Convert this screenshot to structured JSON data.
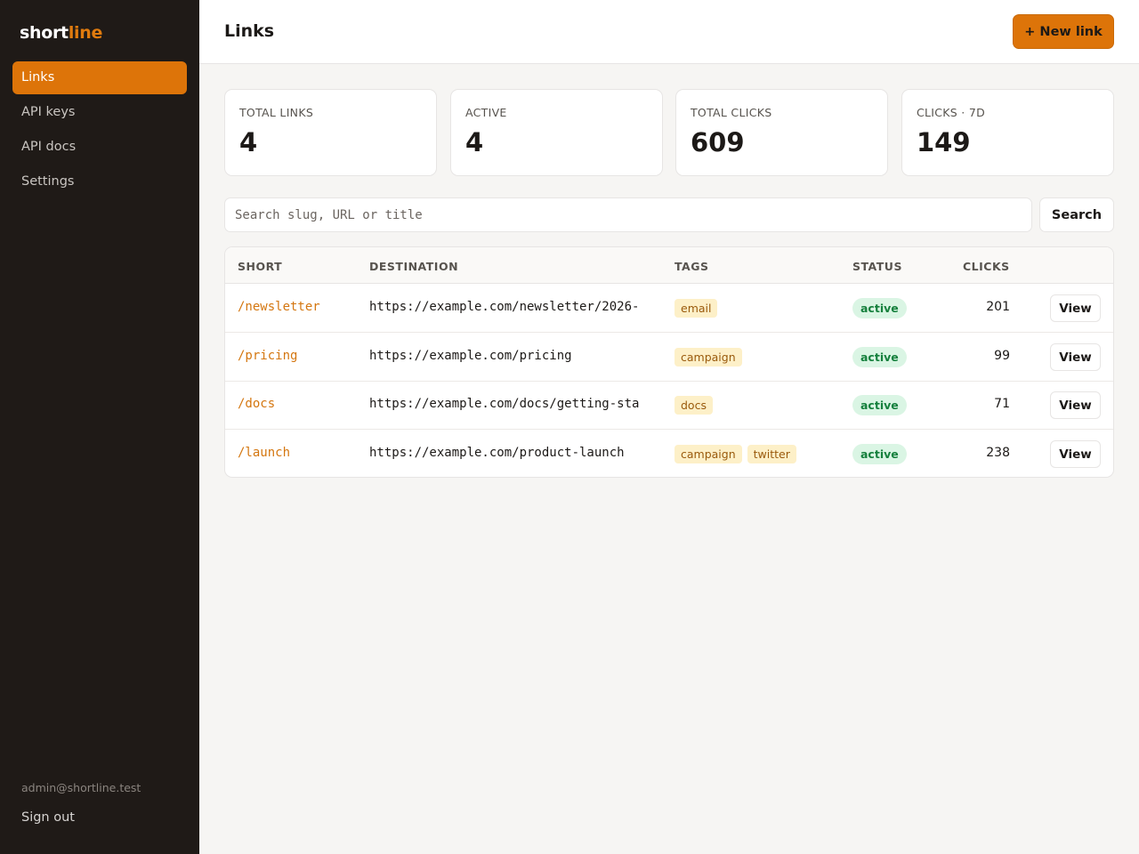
{
  "brand": {
    "part1": "short",
    "part2": "line"
  },
  "sidebar": {
    "items": [
      {
        "label": "Links"
      },
      {
        "label": "API keys"
      },
      {
        "label": "API docs"
      },
      {
        "label": "Settings"
      }
    ],
    "user_email": "admin@shortline.test",
    "sign_out": "Sign out"
  },
  "header": {
    "title": "Links",
    "new_link_label": "+ New link"
  },
  "stats": [
    {
      "label": "TOTAL LINKS",
      "value": "4"
    },
    {
      "label": "ACTIVE",
      "value": "4"
    },
    {
      "label": "TOTAL CLICKS",
      "value": "609"
    },
    {
      "label": "CLICKS · 7D",
      "value": "149"
    }
  ],
  "search": {
    "placeholder": "Search slug, URL or title",
    "value": "",
    "button_label": "Search"
  },
  "table": {
    "columns": [
      "SHORT",
      "DESTINATION",
      "TAGS",
      "STATUS",
      "CLICKS"
    ],
    "rows": [
      {
        "short": "/newsletter",
        "destination": "https://example.com/newsletter/2026-",
        "tags": [
          "email"
        ],
        "status": "active",
        "clicks": "201",
        "action": "View"
      },
      {
        "short": "/pricing",
        "destination": "https://example.com/pricing",
        "tags": [
          "campaign"
        ],
        "status": "active",
        "clicks": "99",
        "action": "View"
      },
      {
        "short": "/docs",
        "destination": "https://example.com/docs/getting-sta",
        "tags": [
          "docs"
        ],
        "status": "active",
        "clicks": "71",
        "action": "View"
      },
      {
        "short": "/launch",
        "destination": "https://example.com/product-launch",
        "tags": [
          "campaign",
          "twitter"
        ],
        "status": "active",
        "clicks": "238",
        "action": "View"
      }
    ]
  },
  "colors": {
    "accent": "#dd7409",
    "sidebar_bg": "#1f1a17",
    "tag_bg": "#fdf0c8",
    "status_bg": "#daf5e4",
    "status_text": "#15803d"
  }
}
